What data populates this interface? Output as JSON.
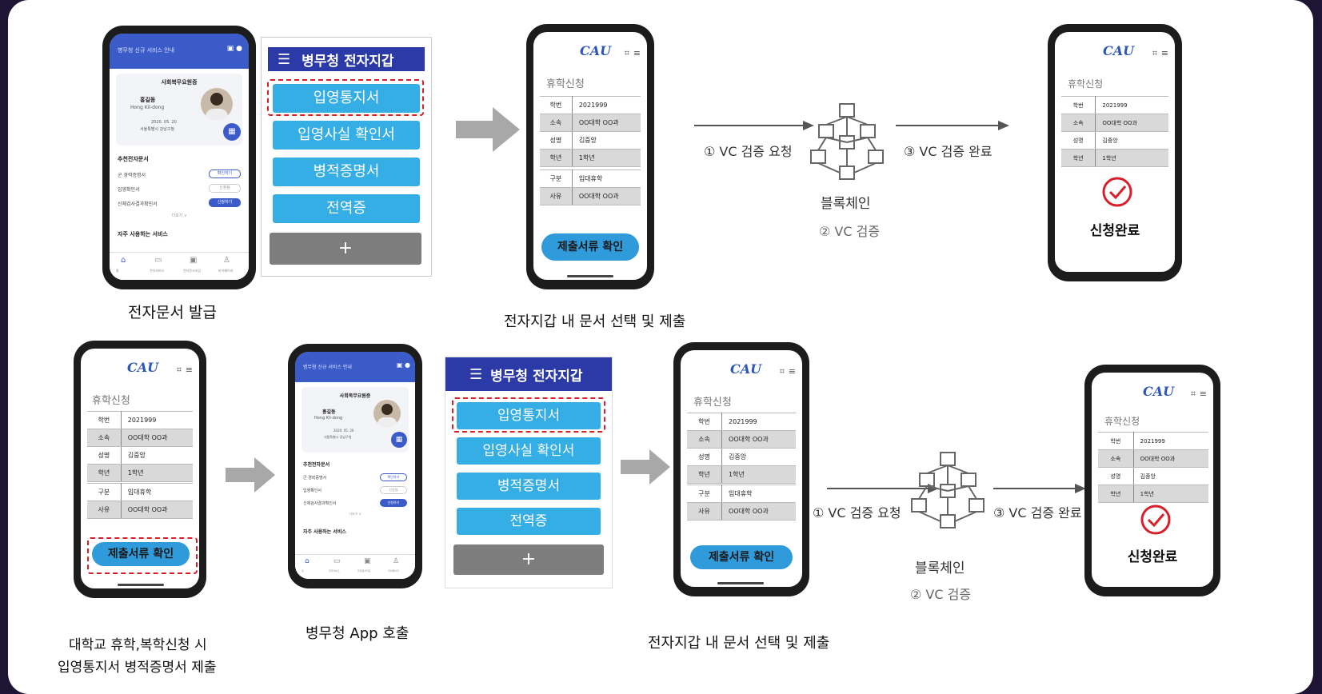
{
  "army_app": {
    "topbar_text": "병무청 신규 서비스 안내",
    "card_title": "사회복무요원증",
    "name": "홍길동",
    "name_en": "Hong Kil-dong",
    "date": "2020. 05. 20",
    "addr": "서울특별시 강남구청",
    "section1": "추천전자문서",
    "rows": [
      "군 경력증명서",
      "입영확인서",
      "신체검사결과확인서"
    ],
    "pills": [
      "확인하기",
      "신청됨",
      "신청하기"
    ],
    "more": "더보기 ∨",
    "section2": "자주 사용하는 서비스",
    "nav": [
      "홈",
      "전자서비스",
      "전자문서지갑",
      "마이페이지"
    ]
  },
  "wallet": {
    "title": "병무청 전자지갑",
    "items": [
      "입영통지서",
      "입영사실 확인서",
      "병적증명서",
      "전역증"
    ],
    "plus": "+"
  },
  "cau_form": {
    "logo": "CAU",
    "title": "휴학신청",
    "rows": [
      [
        "학번",
        "2021999"
      ],
      [
        "소속",
        "OO대학 OO과"
      ],
      [
        "성명",
        "김중앙"
      ],
      [
        "학년",
        "1학년"
      ]
    ],
    "rows2": [
      [
        "구분",
        "입대휴학"
      ],
      [
        "사유",
        "OO대학 OO과"
      ]
    ],
    "submit": "제출서류 확인"
  },
  "complete": {
    "text": "신청완료"
  },
  "flow": {
    "step1": "① VC 검증 요청",
    "step2": "② VC 검증",
    "step3": "③ VC 검증 완료",
    "blockchain": "블록체인"
  },
  "captions": {
    "issue": "전자문서 발급",
    "select_submit": "전자지갑 내 문서 선택 및 제출",
    "univ_line1": "대학교 휴학,복학신청 시",
    "univ_line2": "입영통지서 병적증명서 제출",
    "call_app": "병무청 App 호출"
  },
  "colors": {
    "wallet_header": "#2b3aa6",
    "wallet_button": "#34aee5",
    "highlight": "#d8202a",
    "submit": "#2f9bdb",
    "logo": "#2c56b8"
  }
}
